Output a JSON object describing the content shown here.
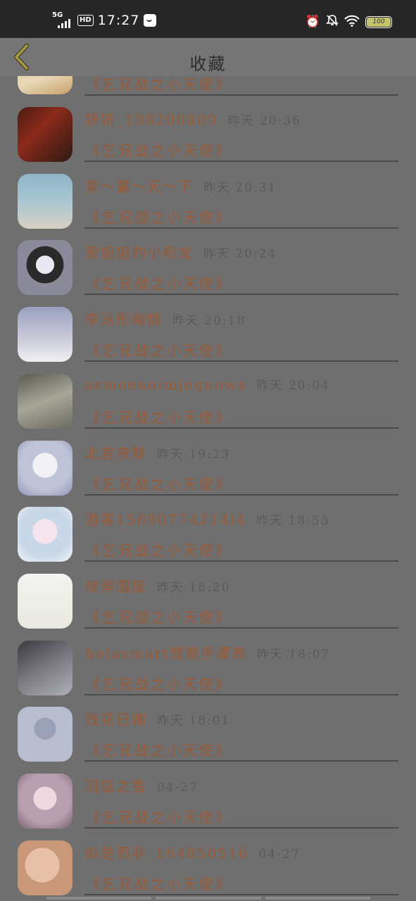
{
  "status_bar": {
    "network": "5G",
    "hd": "HD",
    "time": "17:27",
    "battery": "100"
  },
  "header": {
    "title": "收藏"
  },
  "partial_item": {
    "work": "《乞兄战之小天使》"
  },
  "items": [
    {
      "name": "妍妍_198290809",
      "time": "昨天 20:36",
      "work": "《乞兄战之小天使》"
    },
    {
      "name": "笑～赢～天～下",
      "time": "昨天 20:31",
      "work": "《乞兄战之小天使》"
    },
    {
      "name": "爱姐姐的小粉龙",
      "time": "昨天 20:24",
      "work": "《乞兄战之小天使》"
    },
    {
      "name": "李泳彤晦情",
      "time": "昨天 20:18",
      "work": "《乞兄战之小天使》"
    },
    {
      "name": "armoeanimjeqanws",
      "time": "昨天 20:04",
      "work": "《乞兄战之小天使》"
    },
    {
      "name": "北宫夜黎",
      "time": "昨天 19:23",
      "work": "《乞兄战之小天使》"
    },
    {
      "name": "游客15690774214l4",
      "time": "昨天 18:53",
      "work": "《乞兄战之小天使》"
    },
    {
      "name": "彼岸国度",
      "time": "昨天 18:20",
      "work": "《乞兄战之小天使》"
    },
    {
      "name": "holasmart智能手灈表",
      "time": "昨天 18:07",
      "work": "《乞兄战之小天使》"
    },
    {
      "name": "残花已谢",
      "time": "昨天 18:01",
      "work": "《乞兄战之小天使》"
    },
    {
      "name": "羽弦之香",
      "time": "04-27",
      "work": "《乞兄战之小天使》"
    },
    {
      "name": "似是而非_164850516",
      "time": "04-27",
      "work": "《乞兄战之小天使》"
    }
  ],
  "colors": {
    "accent_text": "#9a5a38",
    "background_dim": "#6f6f6f"
  }
}
